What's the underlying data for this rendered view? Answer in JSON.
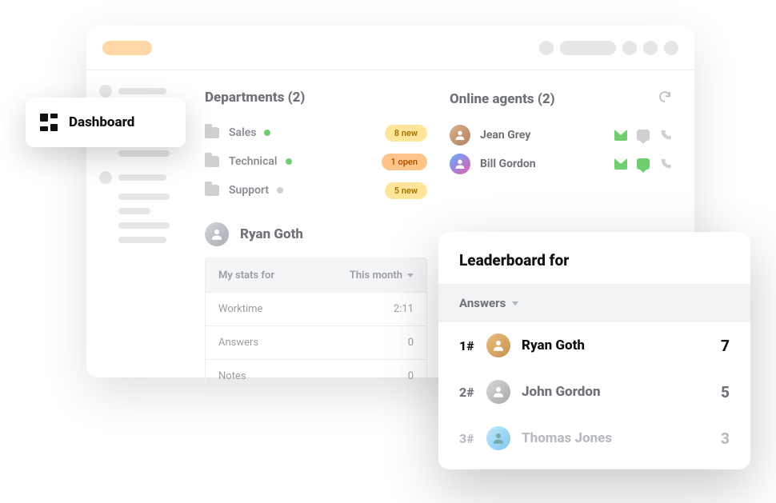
{
  "dashboard_label": "Dashboard",
  "departments": {
    "title": "Departments (2)",
    "items": [
      {
        "name": "Sales",
        "status": "green",
        "badge": "8 new",
        "badge_style": "yellow"
      },
      {
        "name": "Technical",
        "status": "green",
        "badge": "1 open",
        "badge_style": "orange"
      },
      {
        "name": "Support",
        "status": "gray",
        "badge": "5 new",
        "badge_style": "yellow"
      }
    ]
  },
  "agents": {
    "title": "Online agents (2)",
    "items": [
      {
        "name": "Jean Grey",
        "chat_active": false
      },
      {
        "name": "Bill Gordon",
        "chat_active": true
      }
    ]
  },
  "stats": {
    "user": "Ryan Goth",
    "filter_label": "My stats for",
    "filter_value": "This month",
    "rows": [
      {
        "label": "Worktime",
        "value": "2:11"
      },
      {
        "label": "Answers",
        "value": "0"
      },
      {
        "label": "Notes",
        "value": "0"
      }
    ]
  },
  "leaderboard": {
    "title": "Leaderboard for",
    "filter": "Answers",
    "rows": [
      {
        "rank": "1#",
        "name": "Ryan Goth",
        "value": "7"
      },
      {
        "rank": "2#",
        "name": "John Gordon",
        "value": "5"
      },
      {
        "rank": "3#",
        "name": "Thomas Jones",
        "value": "3"
      }
    ]
  }
}
